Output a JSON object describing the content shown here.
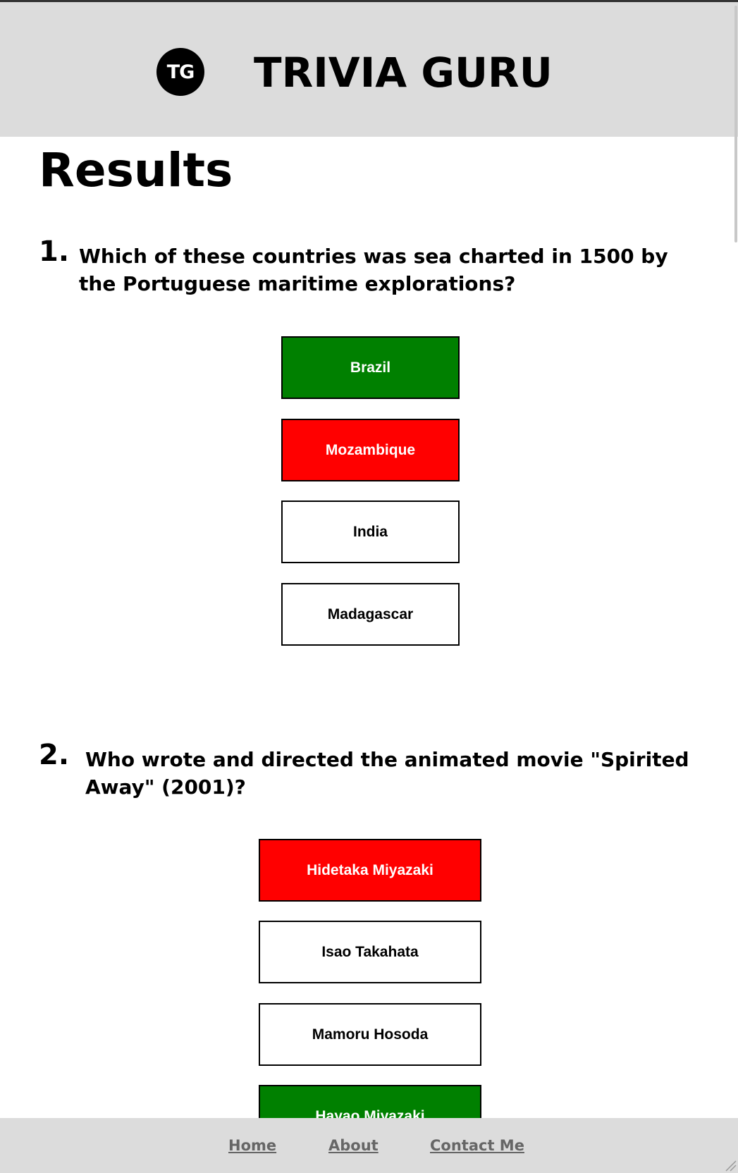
{
  "header": {
    "logo_text": "TG",
    "title": "TRIVIA GURU"
  },
  "page_title": "Results",
  "questions": [
    {
      "number": "1.",
      "text": "Which of these countries was sea charted in 1500 by the Portuguese maritime explorations?",
      "answers": [
        {
          "label": "Brazil",
          "state": "correct"
        },
        {
          "label": "Mozambique",
          "state": "wrong"
        },
        {
          "label": "India",
          "state": "neutral"
        },
        {
          "label": "Madagascar",
          "state": "neutral"
        }
      ]
    },
    {
      "number": "2.",
      "text": "Who wrote and directed the animated movie \"Spirited Away\" (2001)?",
      "answers": [
        {
          "label": "Hidetaka Miyazaki",
          "state": "wrong"
        },
        {
          "label": "Isao Takahata",
          "state": "neutral"
        },
        {
          "label": "Mamoru Hosoda",
          "state": "neutral"
        },
        {
          "label": "Hayao Miyazaki",
          "state": "correct"
        }
      ]
    }
  ],
  "footer": {
    "links": [
      "Home",
      "About",
      "Contact Me"
    ]
  },
  "colors": {
    "correct": "#008000",
    "wrong": "#ff0000",
    "header_bg": "#dcdcdc"
  }
}
